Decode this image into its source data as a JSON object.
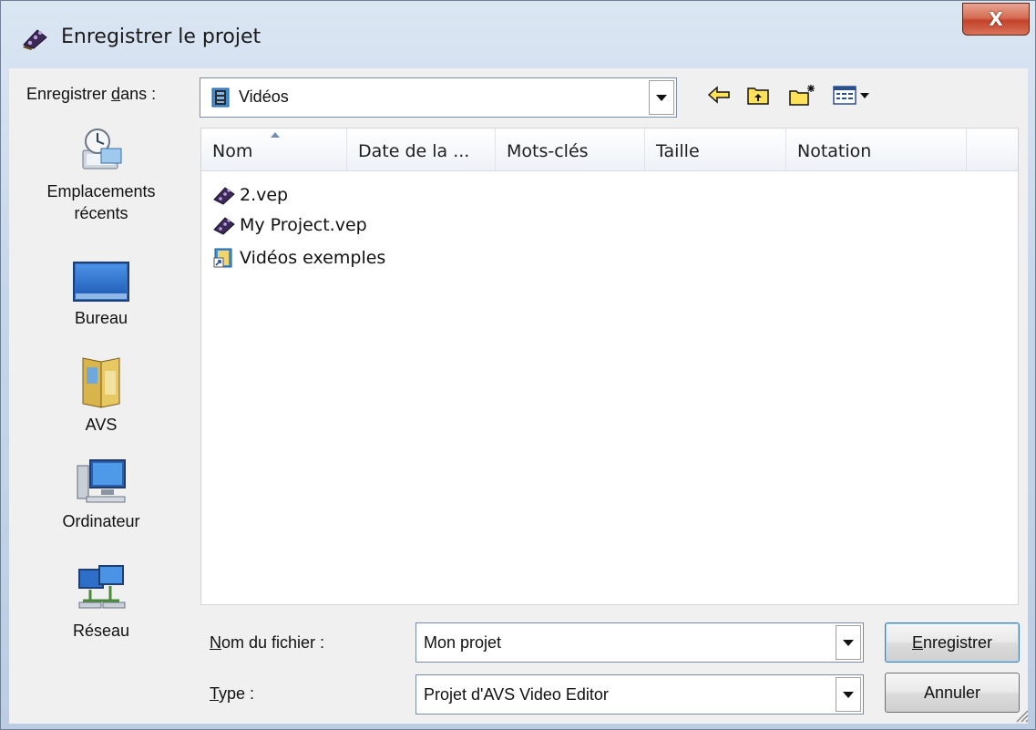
{
  "window": {
    "title": "Enregistrer le projet",
    "close_glyph": "X",
    "icon": "film-reel-icon"
  },
  "save_in": {
    "label_pre": "Enregistrer ",
    "label_accel": "d",
    "label_post": "ans :",
    "folder": "Vidéos",
    "folder_icon": "video-folder-icon"
  },
  "toolbar": {
    "icons": [
      "back-arrow-icon",
      "up-folder-icon",
      "new-folder-icon",
      "view-menu-icon"
    ]
  },
  "places": [
    {
      "label": "Emplacements récents",
      "icon": "recent-places-icon"
    },
    {
      "label": "Bureau",
      "icon": "desktop-icon"
    },
    {
      "label": "AVS",
      "icon": "user-folder-icon"
    },
    {
      "label": "Ordinateur",
      "icon": "computer-icon"
    },
    {
      "label": "Réseau",
      "icon": "network-icon"
    }
  ],
  "columns": [
    "Nom",
    "Date de la ...",
    "Mots-clés",
    "Taille",
    "Notation"
  ],
  "files": [
    {
      "name": "2.vep",
      "icon": "project-file-icon"
    },
    {
      "name": "My Project.vep",
      "icon": "project-file-icon"
    },
    {
      "name": "Vidéos exemples",
      "icon": "folder-shortcut-icon"
    }
  ],
  "filename": {
    "label_accel": "N",
    "label_post": "om du fichier :",
    "value": "Mon projet"
  },
  "filetype": {
    "label_accel": "T",
    "label_post": "ype :",
    "value": "Projet d'AVS Video Editor"
  },
  "buttons": {
    "save_accel": "E",
    "save_post": "nregistrer",
    "cancel": "Annuler"
  },
  "colors": {
    "accent": "#3c7fb1",
    "close": "#c2432a",
    "chrome": "#c6d6ea"
  }
}
